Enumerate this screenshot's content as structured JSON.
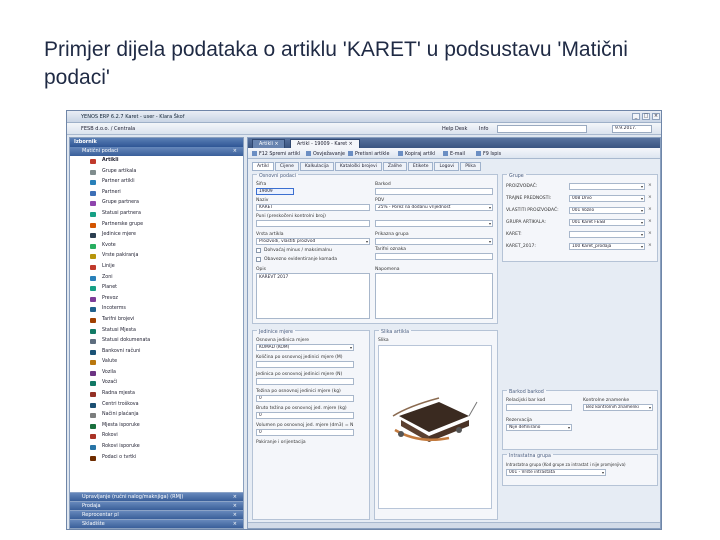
{
  "slide": {
    "title": "Primjer dijela podataka o artiklu 'KARET' u podsustavu 'Matični podaci'"
  },
  "window": {
    "title": "YENOS ERP 6.2.7 Karet - user - Klara Škof",
    "minimize": "_",
    "maximize": "□",
    "close": "×"
  },
  "topbar": {
    "path": "FESB d.o.o. / Centrala",
    "help": "Help Desk",
    "info": "Info",
    "date": "9.9.2017."
  },
  "sidebar": {
    "header": "Izbornik",
    "active_group": "Matični podaci",
    "group_close": "×",
    "items": [
      {
        "label": "Artikli",
        "color": "#c0392b"
      },
      {
        "label": "Grupe artikala",
        "color": "#7f8c8d"
      },
      {
        "label": "Partner artikli",
        "color": "#2980b9"
      },
      {
        "label": "Partneri",
        "color": "#3d6fb6"
      },
      {
        "label": "Grupe partnera",
        "color": "#8e44ad"
      },
      {
        "label": "Statusi partnera",
        "color": "#16a085"
      },
      {
        "label": "Partnerske grupe",
        "color": "#d35400"
      },
      {
        "label": "Jedinice mjere",
        "color": "#2c3e50"
      },
      {
        "label": "Kvote",
        "color": "#27ae60"
      },
      {
        "label": "Vrste pakiranja",
        "color": "#b7950b"
      },
      {
        "label": "Linije",
        "color": "#c0392b"
      },
      {
        "label": "Zoni",
        "color": "#2980b9"
      },
      {
        "label": "Planet",
        "color": "#16a085"
      },
      {
        "label": "Prevoz",
        "color": "#7d3c98"
      },
      {
        "label": "Incoterms",
        "color": "#1f618d"
      },
      {
        "label": "Tarifni brojevi",
        "color": "#a04000"
      },
      {
        "label": "Statusi Mjesta",
        "color": "#117a65"
      },
      {
        "label": "Statusi dokumenata",
        "color": "#5d6d7e"
      },
      {
        "label": "Bankovni računi",
        "color": "#1a5276"
      },
      {
        "label": "Valute",
        "color": "#b9770e"
      },
      {
        "label": "Vozila",
        "color": "#6c3483"
      },
      {
        "label": "Vozači",
        "color": "#117864"
      },
      {
        "label": "Radna mjesta",
        "color": "#943126"
      },
      {
        "label": "Centri troškova",
        "color": "#1b4f72"
      },
      {
        "label": "Načini plaćanja",
        "color": "#7b7d7d"
      },
      {
        "label": "Mjesta isporuke",
        "color": "#196f3d"
      },
      {
        "label": "Rokovi",
        "color": "#a93226"
      },
      {
        "label": "Rokovi isporuke",
        "color": "#2874a6"
      },
      {
        "label": "Podaci o tvrtki",
        "color": "#6e2c00"
      }
    ],
    "bottom_groups": [
      {
        "label": "Upravljanje (ručni nalog/maknjiga) (RMJ)"
      },
      {
        "label": "Prodaja"
      },
      {
        "label": "Reprocentar pl"
      },
      {
        "label": "Skladište"
      }
    ]
  },
  "main": {
    "doctabs": [
      "Artikli",
      "Artikl - 19009 - Karet"
    ],
    "doctab_close": "×",
    "toolbar": [
      {
        "label": "F12 Spremi artikl"
      },
      {
        "label": "Osvježavanje"
      },
      {
        "label": "Pretisni artikle"
      },
      {
        "label": "Kopiraj artikl"
      },
      {
        "label": "E-mail"
      },
      {
        "label": "F9 Ispis"
      }
    ],
    "subtabs": [
      "Artikl",
      "Cijene",
      "Kalkulacija",
      "Kataloški brojevi",
      "Zalihe",
      "Etikete",
      "Logovi",
      "Plika"
    ],
    "osnovni": {
      "title": "Osnovni podaci",
      "sifra_label": "Šifra",
      "sifra_value": "19009",
      "barkod_label": "Barkod",
      "barkod_value": "",
      "naziv_label": "Naziv",
      "naziv_value": "KARET",
      "pdv_label": "PDV",
      "pdv_value": "25% - Porez na dodanu vrijednost",
      "puni_label": "Puni (preskočeni kontrolni broj)",
      "vrsta_label": "Vrsta artikla",
      "vrsta_value": "Proizvodi, vlastiti proizvod",
      "prikazna_label": "Prikazna grupa",
      "tarifni_label": "Tarifni oznaka",
      "chk1_label": "Dohvaćaj minus / maksimalnu",
      "chk2_label": "Obavezno evidentiranje komada",
      "opis_label": "Opis",
      "opis_value": "KAREVT 2017",
      "napomena_label": "Napomena",
      "napomena_value": ""
    },
    "mjere": {
      "title": "Jedinice mjere",
      "l1": "Osnovna jedinica mjere",
      "v1": "KOMAD (KOM)",
      "l2": "Količina po osnovnoj jedinici mjere (M)",
      "l3": "Jedinica po osnovnoj jedinici mjere (N)",
      "l4": "Težina po osnovnoj jedinici mjere (kg)",
      "v4": "0",
      "l5": "Bruto težina po osnovnoj jed. mjere (kg)",
      "v5": "0",
      "l6": "Volumen po osnovnoj jed. mjere (dm3) = N",
      "v6": "0",
      "l7": "Pakiranje i orijentacija",
      "v7": ""
    },
    "slika": {
      "title": "Slika artikla",
      "label": "Slika"
    },
    "grupe": {
      "title": "Grupe",
      "rows": [
        {
          "label": "PROIZVOĐAČ:",
          "value": ""
        },
        {
          "label": "TRAJNE PREDNOSTI:",
          "value": "008 Drvo"
        },
        {
          "label": "VLASTITI PROIZVOĐAČ:",
          "value": "001 Vozilo"
        },
        {
          "label": "GRUPA ARTIKALA:",
          "value": "001 Karet FESB"
        },
        {
          "label": "KARET:",
          "value": ""
        },
        {
          "label": "KARET_2017:",
          "value": "100 Karet_prodaja"
        }
      ]
    },
    "barkod": {
      "title": "Barkod barkod",
      "l1": "Relacijski bar kod",
      "l2": "Kontrolne znamenke",
      "v2": "Bez kontrolnih znamenki",
      "l3": "Rezervacija",
      "v3": "Nije definirano"
    },
    "intrastat": {
      "title": "Intrastatna grupa",
      "l1": "Intrastatna grupa (Kod grupe za intrastat i nije promjenjiva)",
      "v1": "001 - Vrste intrastata"
    }
  }
}
